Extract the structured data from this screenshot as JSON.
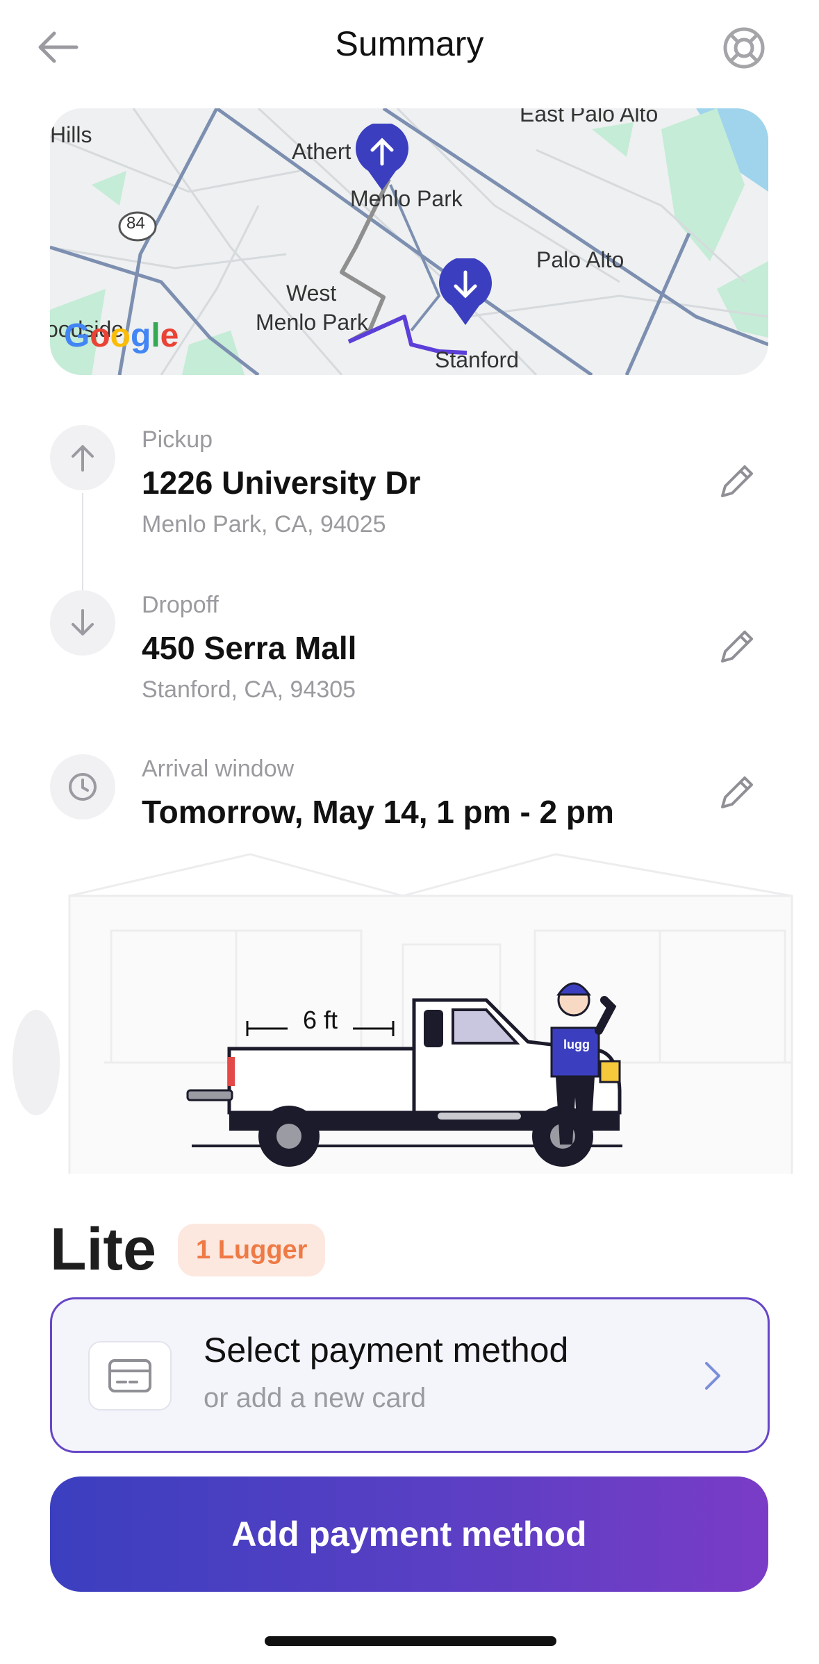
{
  "header": {
    "title": "Summary",
    "back_icon": "arrow-left-icon",
    "help_icon": "lifebuoy-icon"
  },
  "map": {
    "places": [
      "Hills",
      "East Palo Alto",
      "Athert",
      "Menlo Park",
      "84",
      "Palo Alto",
      "West",
      "Menlo Park",
      "Stanford",
      "oodside"
    ],
    "logo": "Google",
    "pickup_marker_icon": "arrow-up-icon",
    "dropoff_marker_icon": "arrow-down-icon"
  },
  "pickup": {
    "label": "Pickup",
    "address": "1226 University Dr",
    "city": "Menlo Park, CA, 94025",
    "icon": "arrow-up-icon"
  },
  "dropoff": {
    "label": "Dropoff",
    "address": "450 Serra Mall",
    "city": "Stanford, CA, 94305",
    "icon": "arrow-down-icon"
  },
  "arrival": {
    "label": "Arrival window",
    "value": "Tomorrow, May 14, 1 pm - 2 pm",
    "icon": "clock-icon"
  },
  "vehicle": {
    "bed_length": "6 ft",
    "shirt_text": "lugg"
  },
  "plan": {
    "name": "Lite",
    "badge": "1 Lugger"
  },
  "payment": {
    "title": "Select payment method",
    "subtitle": "or add a new card",
    "icon": "credit-card-icon"
  },
  "cta": {
    "label": "Add payment method"
  },
  "colors": {
    "accent": "#3b3fbf",
    "accent_end": "#7a3cc6",
    "badge_text": "#ee7a45",
    "badge_bg": "#fde8df",
    "card_border": "#6646c7"
  }
}
